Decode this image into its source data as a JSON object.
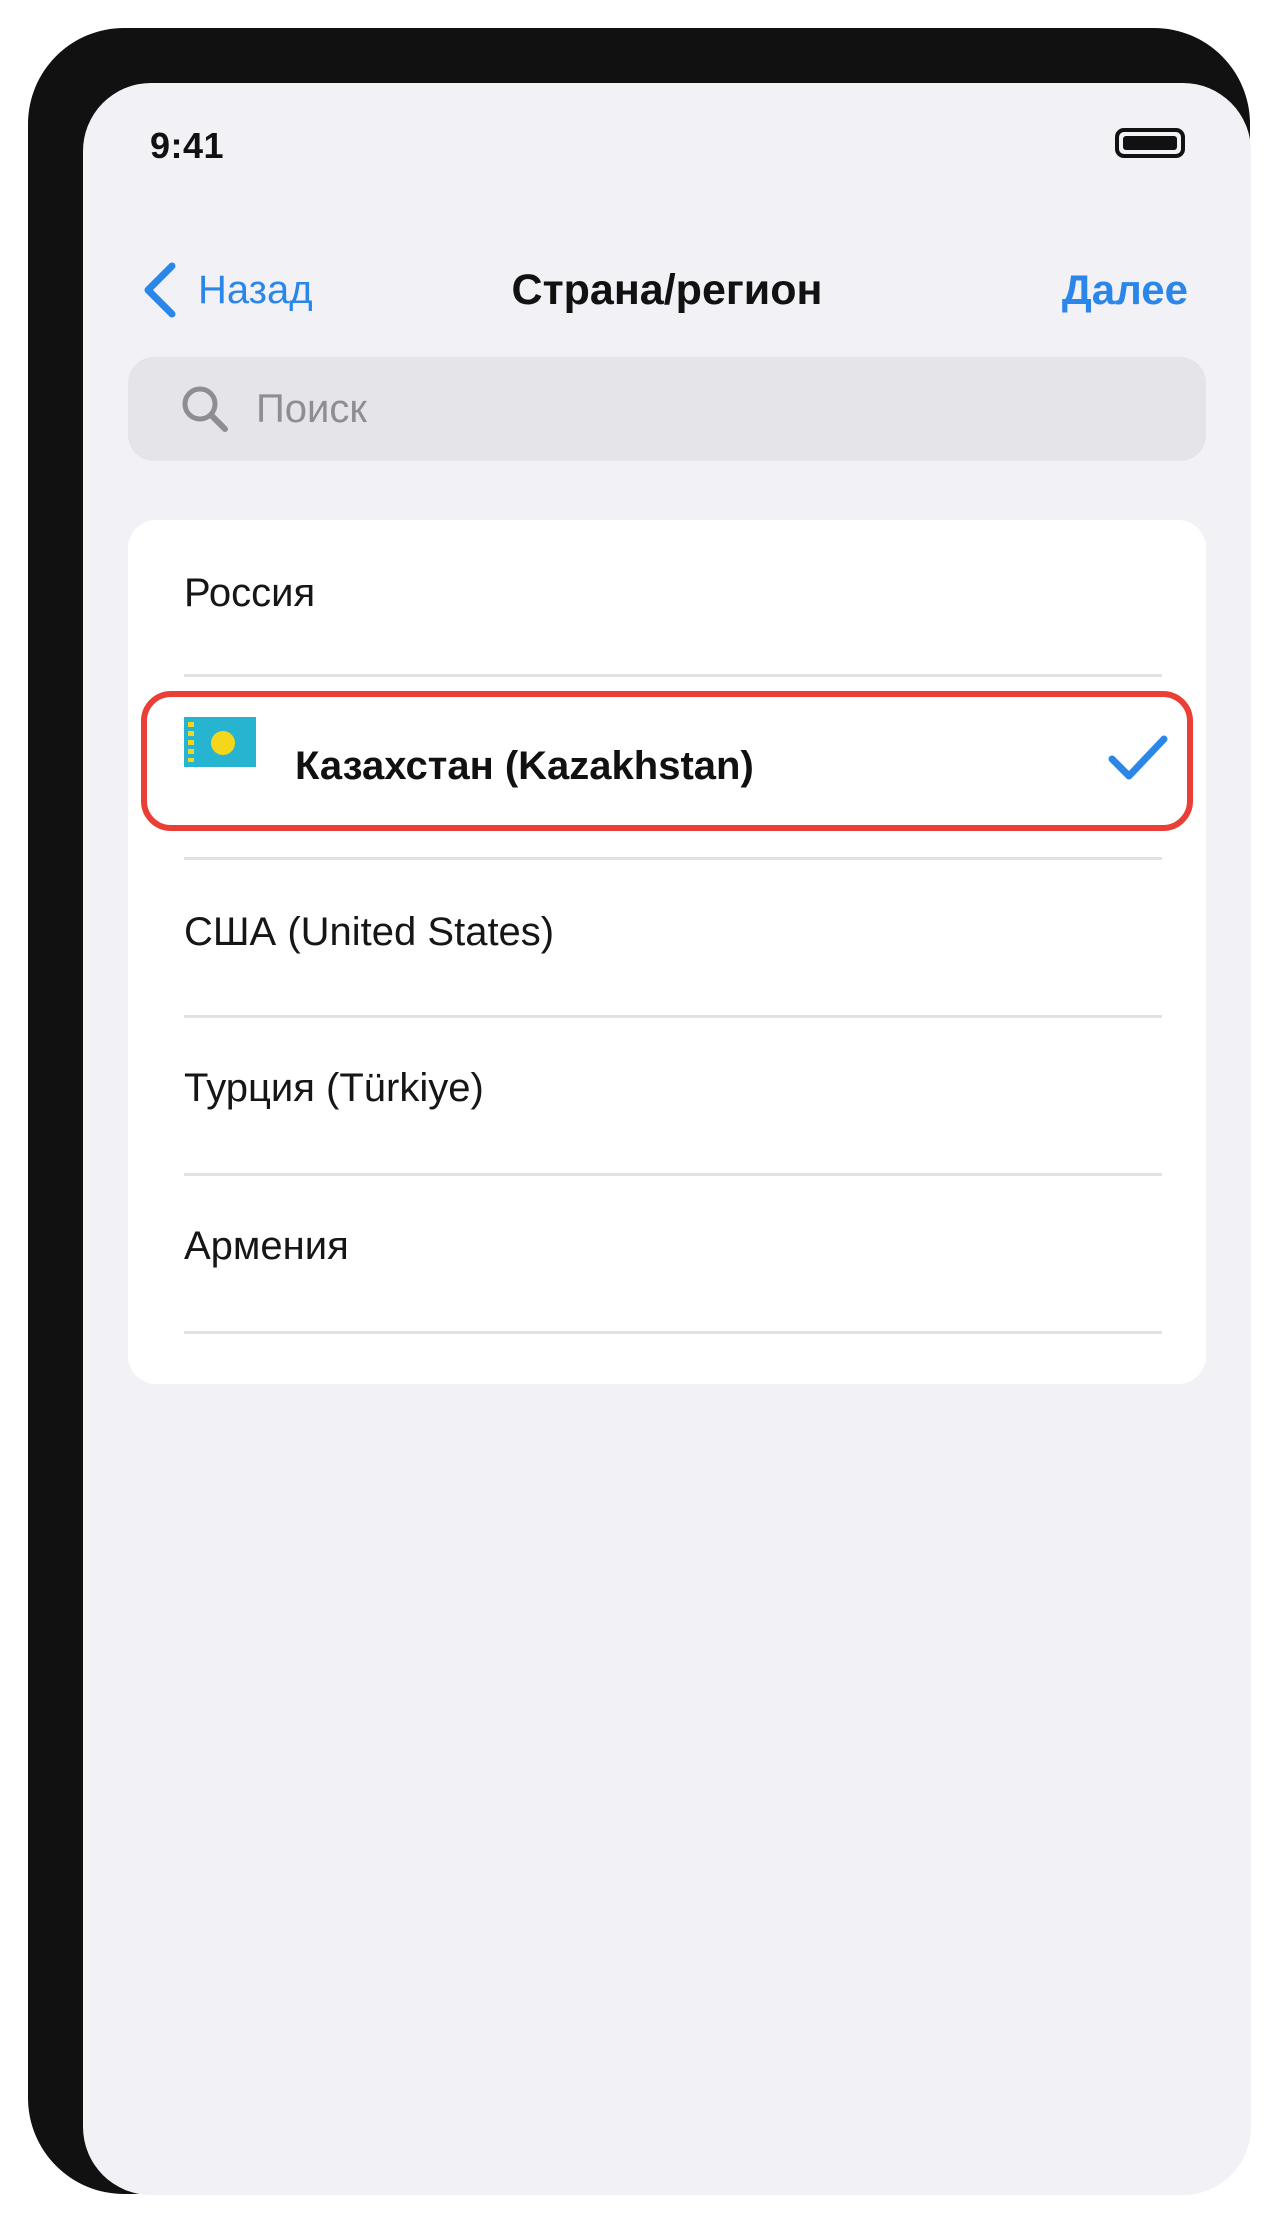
{
  "status_bar": {
    "time": "9:41",
    "battery_icon": "battery-full-icon"
  },
  "nav": {
    "back_label": "Назад",
    "back_icon": "chevron-left-icon",
    "title": "Страна/регион",
    "next_label": "Далее"
  },
  "search": {
    "placeholder": "Поиск",
    "value": "",
    "icon": "magnifier-icon"
  },
  "countries": [
    {
      "label": "Россия",
      "selected": false
    },
    {
      "label": "Казахстан (Kazakhstan)",
      "selected": true,
      "flag": "kazakhstan-flag-icon"
    },
    {
      "label": "США (United States)",
      "selected": false
    },
    {
      "label": "Турция (Türkiye)",
      "selected": false
    },
    {
      "label": "Армения",
      "selected": false
    }
  ],
  "colors": {
    "accent": "#2a86e9",
    "highlight_border": "#ea3f36",
    "screen_background": "#f1f1f6",
    "search_background": "#e4e4e9"
  }
}
